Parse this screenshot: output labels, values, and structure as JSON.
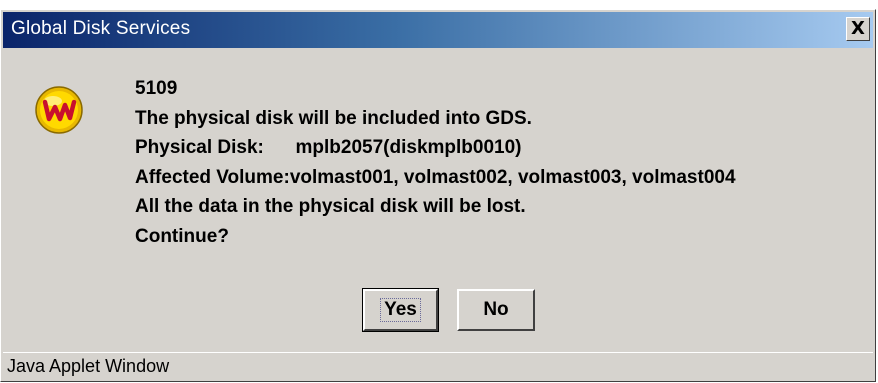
{
  "window": {
    "title": "Global Disk Services",
    "close_label": "X"
  },
  "dialog": {
    "icon": "app-w-icon",
    "message_lines": [
      "5109",
      "The physical disk will be included into GDS.",
      "Physical Disk:      mplb2057(diskmplb0010)",
      "Affected Volume:volmast001, volmast002, volmast003, volmast004",
      "All the data in the physical disk will be lost.",
      "Continue?"
    ],
    "buttons": {
      "yes_label": "Yes",
      "no_label": "No"
    }
  },
  "status_bar": {
    "text": "Java Applet Window"
  },
  "colors": {
    "dialog_bg": "#d6d3ce",
    "title_start": "#0a246a",
    "title_end": "#a6caf0",
    "icon_fill": "#f2c200",
    "icon_letter": "#c8102e"
  }
}
